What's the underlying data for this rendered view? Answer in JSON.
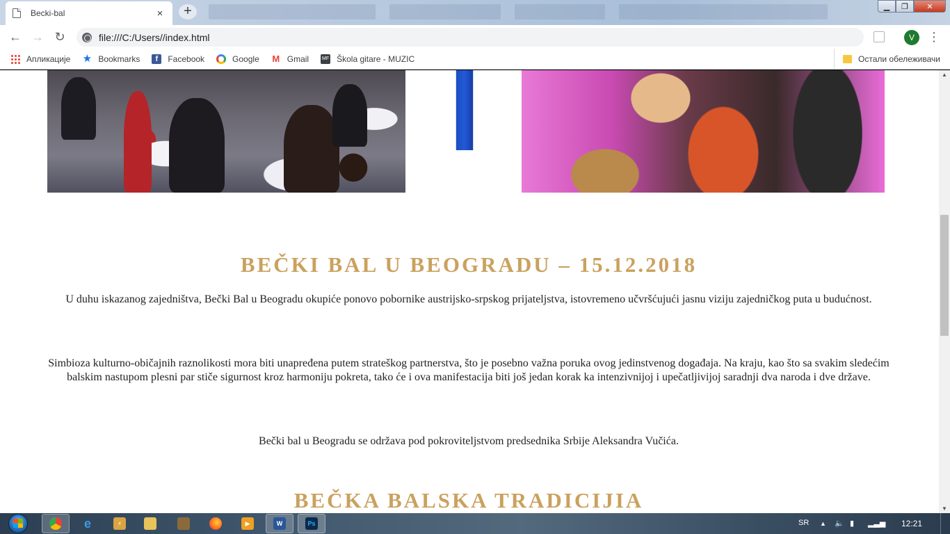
{
  "browser": {
    "tab_title": "Becki-bal",
    "tab_close": "×",
    "new_tab": "+",
    "url": "file:///C:/Users//index.html",
    "profile_initial": "V",
    "back_glyph": "←",
    "forward_glyph": "→",
    "reload_glyph": "↻",
    "menu_glyph": "⋮"
  },
  "bookmarks": {
    "items": [
      {
        "label": "Апликације",
        "icon": "apps-icon"
      },
      {
        "label": "Bookmarks",
        "icon": "star-icon"
      },
      {
        "label": "Facebook",
        "icon": "facebook-icon"
      },
      {
        "label": "Google",
        "icon": "google-icon"
      },
      {
        "label": "Gmail",
        "icon": "gmail-icon"
      },
      {
        "label": "Škola gitare - MUZIC",
        "icon": "mf-icon"
      }
    ],
    "other": "Остали обележивачи"
  },
  "page": {
    "heading1": "BEČKI BAL U BEOGRADU – 15.12.2018",
    "paragraph1": "U duhu iskazanog zajedništva, Bečki Bal u Beogradu okupiće ponovo pobornike austrijsko-srpskog prijateljstva, istovremeno učvršćujući jasnu viziju zajedničkog puta u budućnost.",
    "paragraph2": "Simbioza kulturno-običajnih raznolikosti mora biti unapređena putem strateškog partnerstva, što je posebno važna poruka ovog jedinstvenog događaja. Na kraju, kao što sa svakim sledećim balskim nastupom plesni par stiče sigurnost kroz harmoniju pokreta, tako će i ova manifestacija biti još jedan korak ka intenzivnijoj i upečatljivijoj saradnji dva naroda i dve države.",
    "paragraph3": "Bečki bal u Beogradu se održava pod pokroviteljstvom predsednika Srbije Aleksandra Vučića.",
    "heading2": "BEČKA BALSKA TRADICIJIA",
    "accent_color": "#caa15e"
  },
  "taskbar": {
    "language": "SR",
    "clock": "12:21",
    "apps": [
      "chrome",
      "internet-explorer",
      "winamp",
      "explorer",
      "media",
      "firefox",
      "media-player",
      "word",
      "photoshop"
    ]
  }
}
